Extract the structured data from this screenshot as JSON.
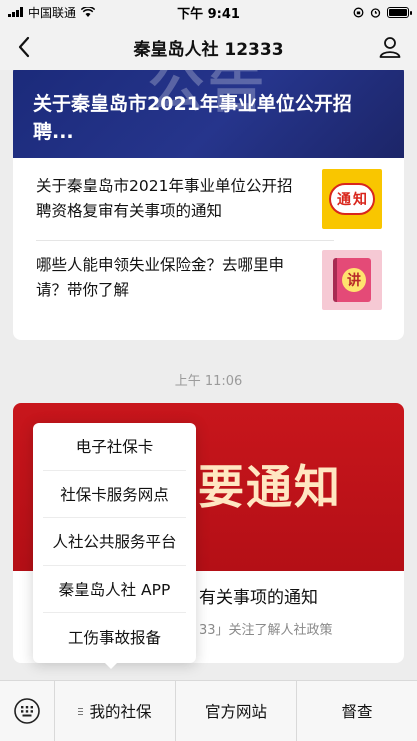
{
  "status_bar": {
    "carrier": "中国联通",
    "time": "下午 9:41"
  },
  "nav": {
    "title": "秦皇岛人社 12333"
  },
  "card1": {
    "cover_title": "关于秦皇岛市2021年事业单位公开招聘...",
    "cover_bg_text": "公告",
    "articles": [
      {
        "title": "关于秦皇岛市2021年事业单位公开招聘资格复审有关事项的通知",
        "thumb_text": [
          "通",
          "知"
        ]
      },
      {
        "title": "哪些人能申领失业保险金？去哪里申请？带你了解",
        "thumb_text": "讲"
      }
    ]
  },
  "timestamp": "上午 11:06",
  "card2": {
    "cover_text": "要通知",
    "title": "有关事项的通知",
    "subtitle": "33」关注了解人社政策"
  },
  "popup_menu": {
    "items": [
      "电子社保卡",
      "社保卡服务网点",
      "人社公共服务平台",
      "秦皇岛人社 APP",
      "工伤事故报备"
    ]
  },
  "bottom_menu": {
    "tabs": [
      "我的社保",
      "官方网站",
      "督查"
    ]
  },
  "colors": {
    "nav_bg": "#f2f2f2",
    "page_bg": "#ededed",
    "cover1_bg": "#1b2a7a",
    "cover2_bg": "#c8161c"
  }
}
